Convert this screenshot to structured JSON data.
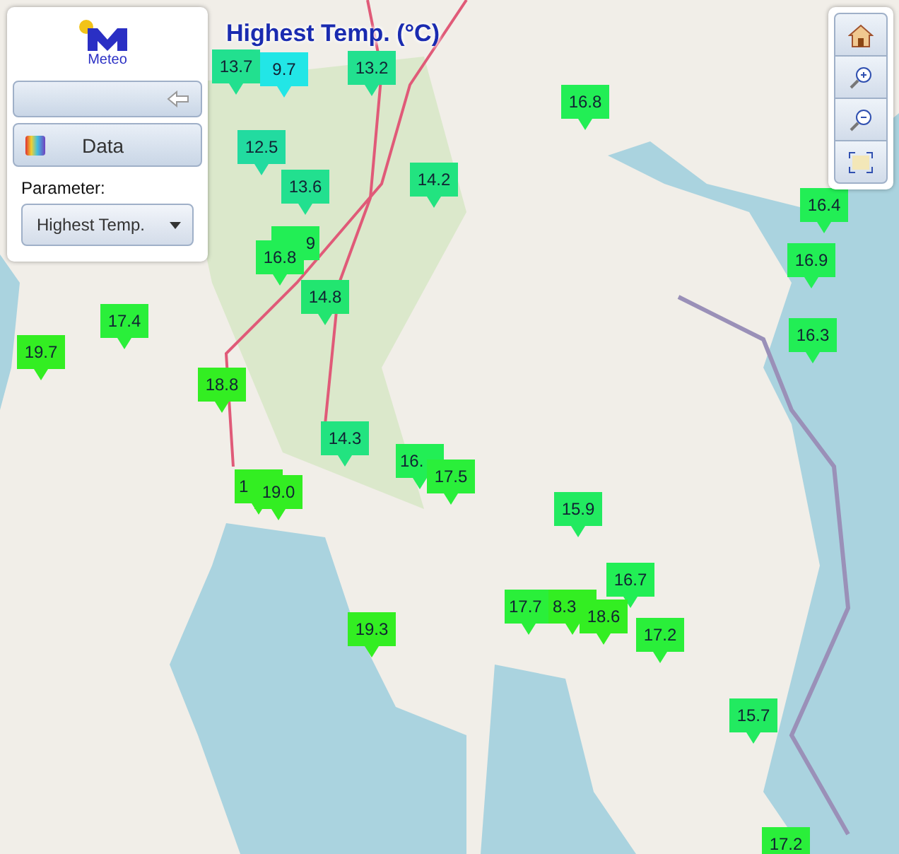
{
  "title": "Highest Temp. (°C)",
  "panel": {
    "logo_text": "Meteo",
    "data_button": "Data",
    "parameter_label": "Parameter:",
    "parameter_select": {
      "value": "Highest Temp."
    }
  },
  "markers": [
    {
      "value": "13.7",
      "color": "#22e08f"
    },
    {
      "value": "9.7",
      "color": "#22e6e6"
    },
    {
      "value": "13.2",
      "color": "#22e08f"
    },
    {
      "value": "12.5",
      "color": "#22dba0"
    },
    {
      "value": "13.6",
      "color": "#22e08f"
    },
    {
      "value": "14.2",
      "color": "#22e380"
    },
    {
      "value": "9",
      "color": "#22ee55"
    },
    {
      "value": "16.8",
      "color": "#22ee55"
    },
    {
      "value": "14.8",
      "color": "#22e570"
    },
    {
      "value": "17.4",
      "color": "#2aef3a"
    },
    {
      "value": "19.7",
      "color": "#33ee22"
    },
    {
      "value": "18.8",
      "color": "#33ee22"
    },
    {
      "value": "14.3",
      "color": "#22e380"
    },
    {
      "value": "16.",
      "color": "#22ee55"
    },
    {
      "value": "17.5",
      "color": "#2aef3a"
    },
    {
      "value": "1",
      "color": "#33ee22"
    },
    {
      "value": "19.0",
      "color": "#33ee22"
    },
    {
      "value": "19.3",
      "color": "#33ee22"
    },
    {
      "value": "16.8",
      "color": "#22ee55"
    },
    {
      "value": "16.4",
      "color": "#22ee55"
    },
    {
      "value": "16.9",
      "color": "#22ee55"
    },
    {
      "value": "16.3",
      "color": "#22ee55"
    },
    {
      "value": "15.9",
      "color": "#22ea60"
    },
    {
      "value": "16.7",
      "color": "#22ee55"
    },
    {
      "value": "17.7",
      "color": "#2aef3a"
    },
    {
      "value": "8.3",
      "color": "#33ee22"
    },
    {
      "value": "18.6",
      "color": "#33ee22"
    },
    {
      "value": "17.2",
      "color": "#2aef3a"
    },
    {
      "value": "15.7",
      "color": "#22ea60"
    },
    {
      "value": "17.2",
      "color": "#2aef3a"
    }
  ]
}
